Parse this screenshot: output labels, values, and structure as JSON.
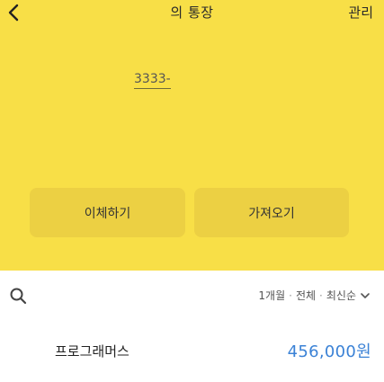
{
  "header": {
    "title": "의 통장",
    "manage_label": "관리"
  },
  "account": {
    "number": "3333-"
  },
  "actions": {
    "transfer_label": "이체하기",
    "fetch_label": "가져오기"
  },
  "filter": {
    "period": "1개월",
    "type": "전체",
    "order": "최신순",
    "separator": "·"
  },
  "transactions": [
    {
      "name": "프로그래머스",
      "amount": "456,000원"
    }
  ],
  "colors": {
    "hero_background": "#f8df47",
    "button_background": "#ecd043",
    "amount_blue": "#3b82d6"
  },
  "icons": {
    "back": "chevron-left-icon",
    "search": "search-icon",
    "dropdown": "chevron-down-icon"
  }
}
